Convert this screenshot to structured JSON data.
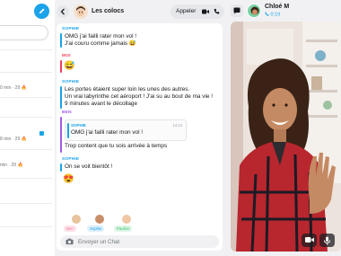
{
  "chat": {
    "title": "Les colocs",
    "call_label": "Appeler",
    "composer_placeholder": "Envoyer un Chat"
  },
  "messages": [
    {
      "sender": "SOPHIE",
      "lines": [
        "OMG j'ai failli rater mon vol !",
        "J'ai couru comme jamais 😅"
      ]
    },
    {
      "sender": "MOI",
      "emoji": "😅"
    },
    {
      "sender": "SOPHIE",
      "lines": [
        "Les portes étaient super loin les unes des autres.",
        "Un vrai labyrinthe cet aéroport ! J'ai su au bout de ma vie !",
        "9 minutes avant le décollage"
      ]
    },
    {
      "sender": "BEN",
      "reply_to": {
        "sender": "SOPHIE",
        "time": "14:13",
        "text": "OMG j'ai failli rater mon vol !"
      },
      "lines": [
        "Trop content que tu sois arrivée à temps"
      ]
    },
    {
      "sender": "SOPHIE",
      "lines": [
        "On se voit bientôt !"
      ]
    },
    {
      "sender": "",
      "emoji": "😍"
    }
  ],
  "typing": [
    {
      "name": "Ben",
      "color": "#f2789a"
    },
    {
      "name": "Sophie",
      "color": "#1aa3e8"
    },
    {
      "name": "Pauline",
      "color": "#39c46b"
    }
  ],
  "sidebar": {
    "rows": [
      {
        "text": "0 min · 29 🔥"
      },
      {
        "text": "8 min · 29 🔥"
      },
      {
        "text": "min · 29 🔥"
      }
    ]
  },
  "call": {
    "name": "Chloé M",
    "duration": "0:19"
  },
  "colors": {
    "accent": "#1aa3e8",
    "moi": "#f23c57",
    "ben": "#a05ce6",
    "sophie": "#1aa3e8"
  }
}
